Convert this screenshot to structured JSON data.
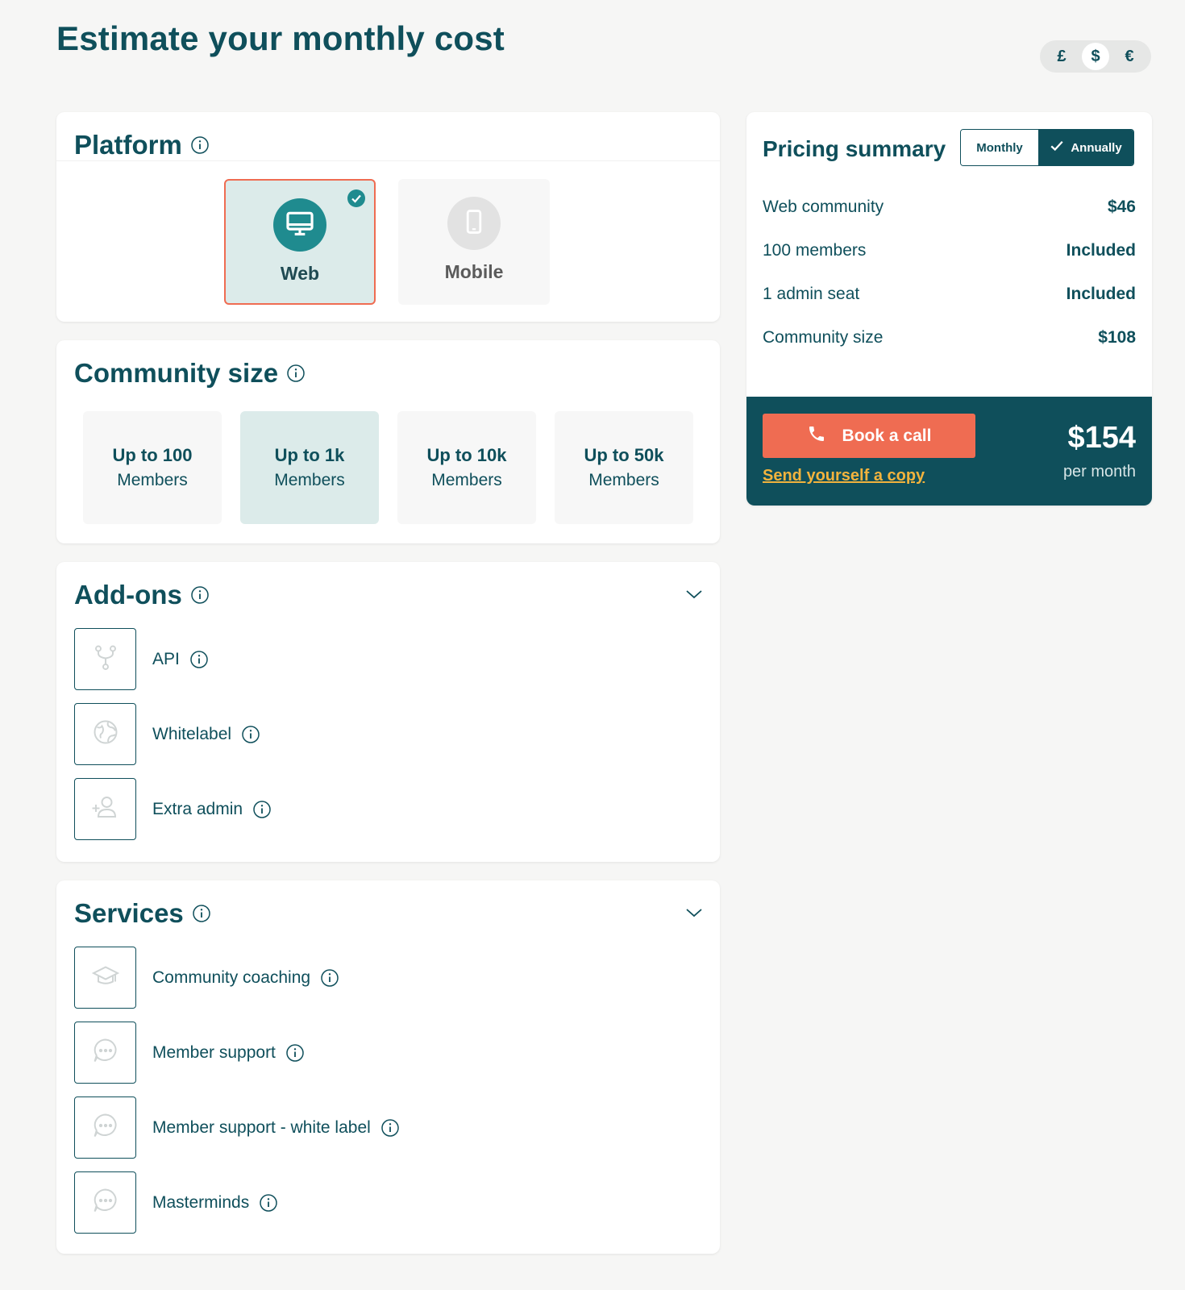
{
  "page_title": "Estimate your monthly cost",
  "currency": {
    "options": [
      "£",
      "$",
      "€"
    ],
    "selected": "$"
  },
  "platform": {
    "title": "Platform",
    "options": [
      {
        "label": "Web",
        "icon": "monitor-icon",
        "selected": true
      },
      {
        "label": "Mobile",
        "icon": "smartphone-icon",
        "selected": false
      }
    ]
  },
  "community_size": {
    "title": "Community size",
    "options": [
      {
        "line1": "Up to 100",
        "line2": "Members",
        "selected": false
      },
      {
        "line1": "Up to 1k",
        "line2": "Members",
        "selected": true
      },
      {
        "line1": "Up to 10k",
        "line2": "Members",
        "selected": false
      },
      {
        "line1": "Up to 50k",
        "line2": "Members",
        "selected": false
      }
    ]
  },
  "addons": {
    "title": "Add-ons",
    "items": [
      {
        "label": "API",
        "icon": "fork-icon"
      },
      {
        "label": "Whitelabel",
        "icon": "globe-icon"
      },
      {
        "label": "Extra admin",
        "icon": "add-user-icon"
      }
    ]
  },
  "services": {
    "title": "Services",
    "items": [
      {
        "label": "Community coaching",
        "icon": "graduation-cap-icon"
      },
      {
        "label": "Member support",
        "icon": "chat-bubble-icon"
      },
      {
        "label": "Member support - white label",
        "icon": "chat-bubble-icon"
      },
      {
        "label": "Masterminds",
        "icon": "chat-bubble-icon"
      }
    ]
  },
  "summary": {
    "title": "Pricing summary",
    "billing": {
      "monthly": "Monthly",
      "annually": "Annually",
      "selected": "Annually"
    },
    "rows": [
      {
        "label": "Web community",
        "value": "$46"
      },
      {
        "label": "100 members",
        "value": "Included"
      },
      {
        "label": "1 admin seat",
        "value": "Included"
      },
      {
        "label": "Community size",
        "value": "$108"
      }
    ],
    "book_label": "Book a call",
    "copy_label": "Send yourself a copy",
    "total": "$154",
    "per": "per month"
  },
  "colors": {
    "primary": "#0f4f5b",
    "accent": "#ef6c52",
    "teal": "#1f8b8f",
    "selected_bg": "#dcebea",
    "link": "#f2b33d"
  }
}
